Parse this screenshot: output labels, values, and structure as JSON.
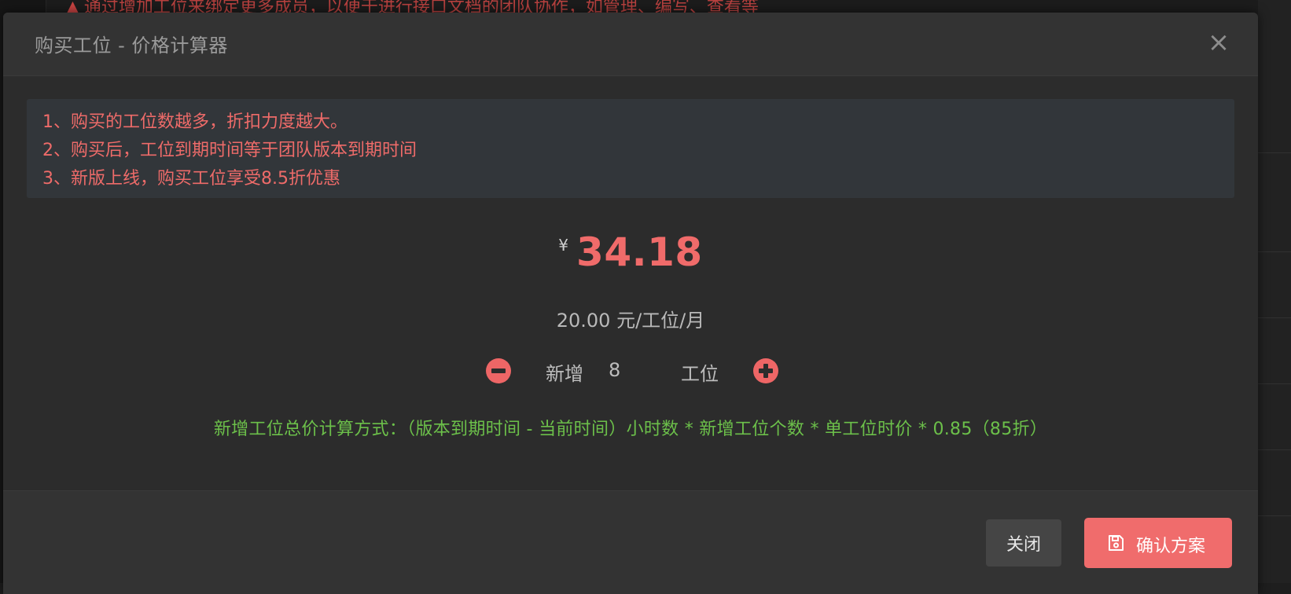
{
  "background": {
    "notice_text": "通过增加工位来绑定更多成员，以便于进行接口文档的团队协作，如管理、编写、查看等"
  },
  "modal": {
    "title": "购买工位 - 价格计算器",
    "close_icon": "×"
  },
  "tips": [
    "1、购买的工位数越多，折扣力度越大。",
    "2、购买后，工位到期时间等于团队版本到期时间",
    "3、新版上线，购买工位享受8.5折优惠"
  ],
  "price": {
    "currency": "¥",
    "amount": "34.18"
  },
  "unit_price": "20.00 元/工位/月",
  "stepper": {
    "add_label": "新增",
    "quantity": "8",
    "unit_label": "工位"
  },
  "formula": "新增工位总价计算方式：（版本到期时间 - 当前时间）小时数 * 新增工位个数 * 单工位时价 * 0.85（85折）",
  "footer": {
    "close_label": "关闭",
    "confirm_label": "确认方案"
  },
  "colors": {
    "accent": "#f06c6c",
    "formula_green": "#6cc04a",
    "modal_bg": "#2c2c2c"
  }
}
